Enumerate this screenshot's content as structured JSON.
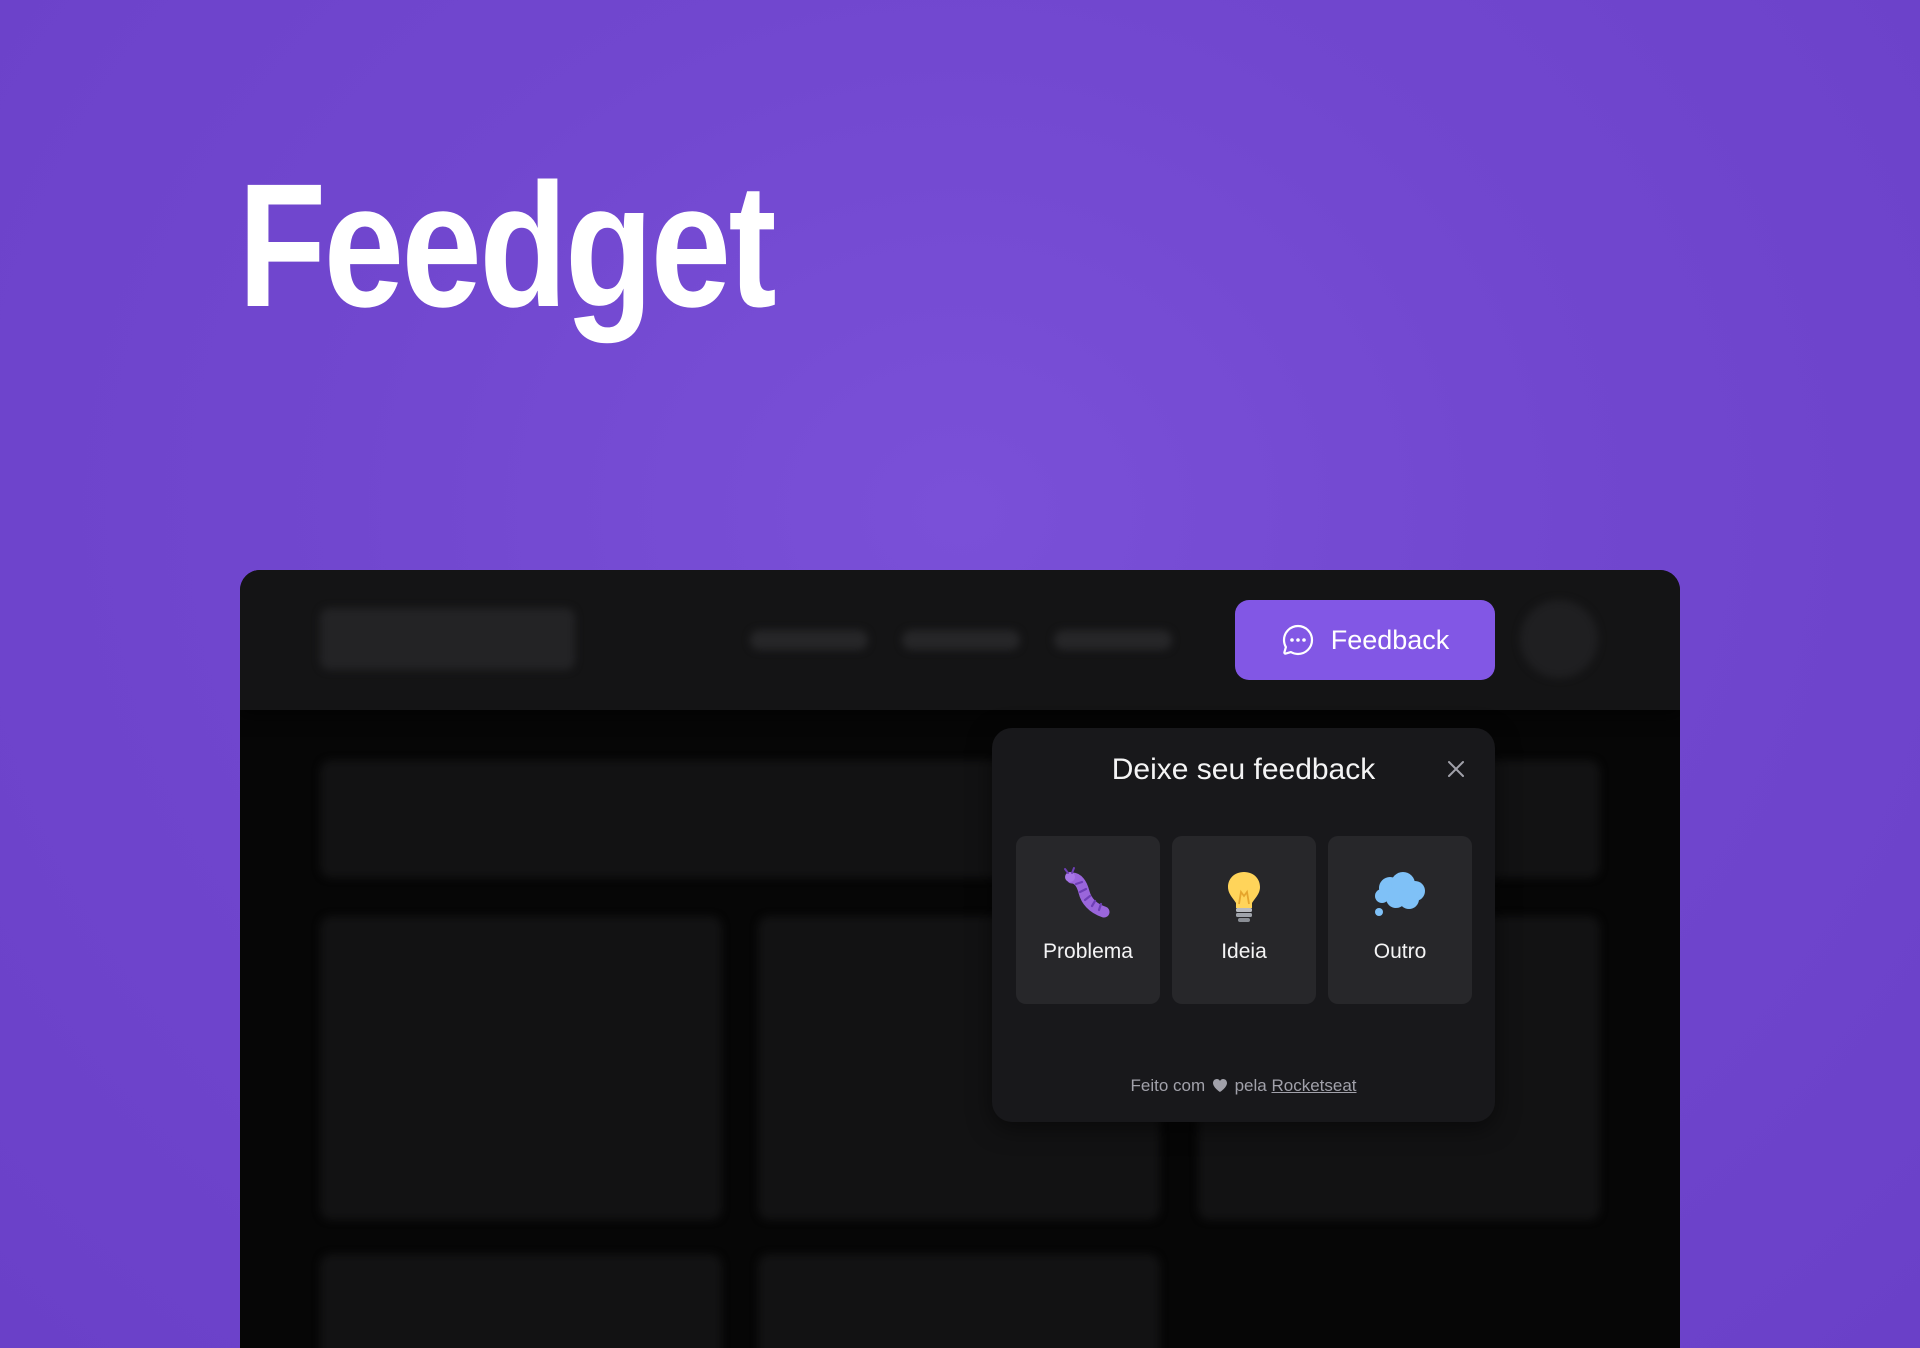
{
  "hero": {
    "title": "Feedget"
  },
  "colors": {
    "brand": "#8257e5",
    "background": "#7147cf",
    "surface": "#18181b",
    "option_bg": "#27272a"
  },
  "header": {
    "feedback_button": {
      "label": "Feedback",
      "icon": "chat-teardrop-dots-icon"
    }
  },
  "widget": {
    "title": "Deixe seu feedback",
    "close_icon": "close-icon",
    "options": [
      {
        "label": "Problema",
        "icon": "bug-icon"
      },
      {
        "label": "Ideia",
        "icon": "lightbulb-icon"
      },
      {
        "label": "Outro",
        "icon": "thought-cloud-icon"
      }
    ],
    "footer": {
      "prefix": "Feito com",
      "heart_icon": "heart-icon",
      "middle": "pela",
      "link": "Rocketseat"
    }
  }
}
